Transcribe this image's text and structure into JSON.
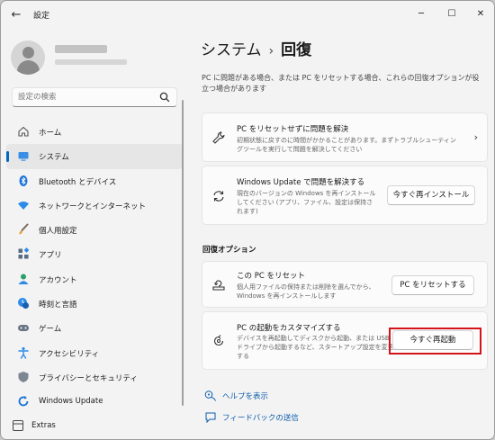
{
  "window": {
    "title": "設定",
    "back_glyph": "←",
    "minimize_glyph": "─",
    "maximize_glyph": "☐",
    "close_glyph": "✕"
  },
  "search": {
    "placeholder": "設定の検索"
  },
  "nav": [
    {
      "label": "ホーム",
      "icon": "home-icon",
      "active": false
    },
    {
      "label": "システム",
      "icon": "system-icon",
      "active": true
    },
    {
      "label": "Bluetooth とデバイス",
      "icon": "bluetooth-icon",
      "active": false
    },
    {
      "label": "ネットワークとインターネット",
      "icon": "wifi-icon",
      "active": false
    },
    {
      "label": "個人用設定",
      "icon": "brush-icon",
      "active": false
    },
    {
      "label": "アプリ",
      "icon": "apps-icon",
      "active": false
    },
    {
      "label": "アカウント",
      "icon": "account-icon",
      "active": false
    },
    {
      "label": "時刻と言語",
      "icon": "time-language-icon",
      "active": false
    },
    {
      "label": "ゲーム",
      "icon": "gamepad-icon",
      "active": false
    },
    {
      "label": "アクセシビリティ",
      "icon": "accessibility-icon",
      "active": false
    },
    {
      "label": "プライバシーとセキュリティ",
      "icon": "shield-icon",
      "active": false
    },
    {
      "label": "Windows Update",
      "icon": "update-icon",
      "active": false
    }
  ],
  "extras": {
    "label": "Extras"
  },
  "breadcrumb": {
    "parent": "システム",
    "separator": "›",
    "current": "回復"
  },
  "description": "PC に問題がある場合、または PC をリセットする場合、これらの回復オプションが役立つ場合があります",
  "cards": {
    "troubleshoot": {
      "title": "PC をリセットせずに問題を解決",
      "subtitle": "初期状態に戻すのに時間がかかることがあります。まずトラブルシューティングツールを実行して問題を解決してください"
    },
    "windows_update": {
      "title": "Windows Update で問題を解決する",
      "subtitle": "現在のバージョンの Windows を再インストールしてください (アプリ、ファイル、設定は保持されます)",
      "button": "今すぐ再インストール"
    }
  },
  "section_title": "回復オプション",
  "recovery": {
    "reset": {
      "title": "この PC をリセット",
      "subtitle": "個人用ファイルの保持または削除を選んでから、Windows を再インストールします",
      "button": "PC をリセットする"
    },
    "advanced": {
      "title": "PC の起動をカスタマイズする",
      "subtitle": "デバイスを再起動してディスクから起動、または USB ドライブから起動するなど、スタートアップ設定を変更する",
      "button": "今すぐ再起動"
    }
  },
  "links": {
    "help": "ヘルプを表示",
    "feedback": "フィードバックの送信"
  },
  "colors": {
    "accent": "#0067c0",
    "highlight": "#d4141a",
    "link": "#0b5cad"
  }
}
